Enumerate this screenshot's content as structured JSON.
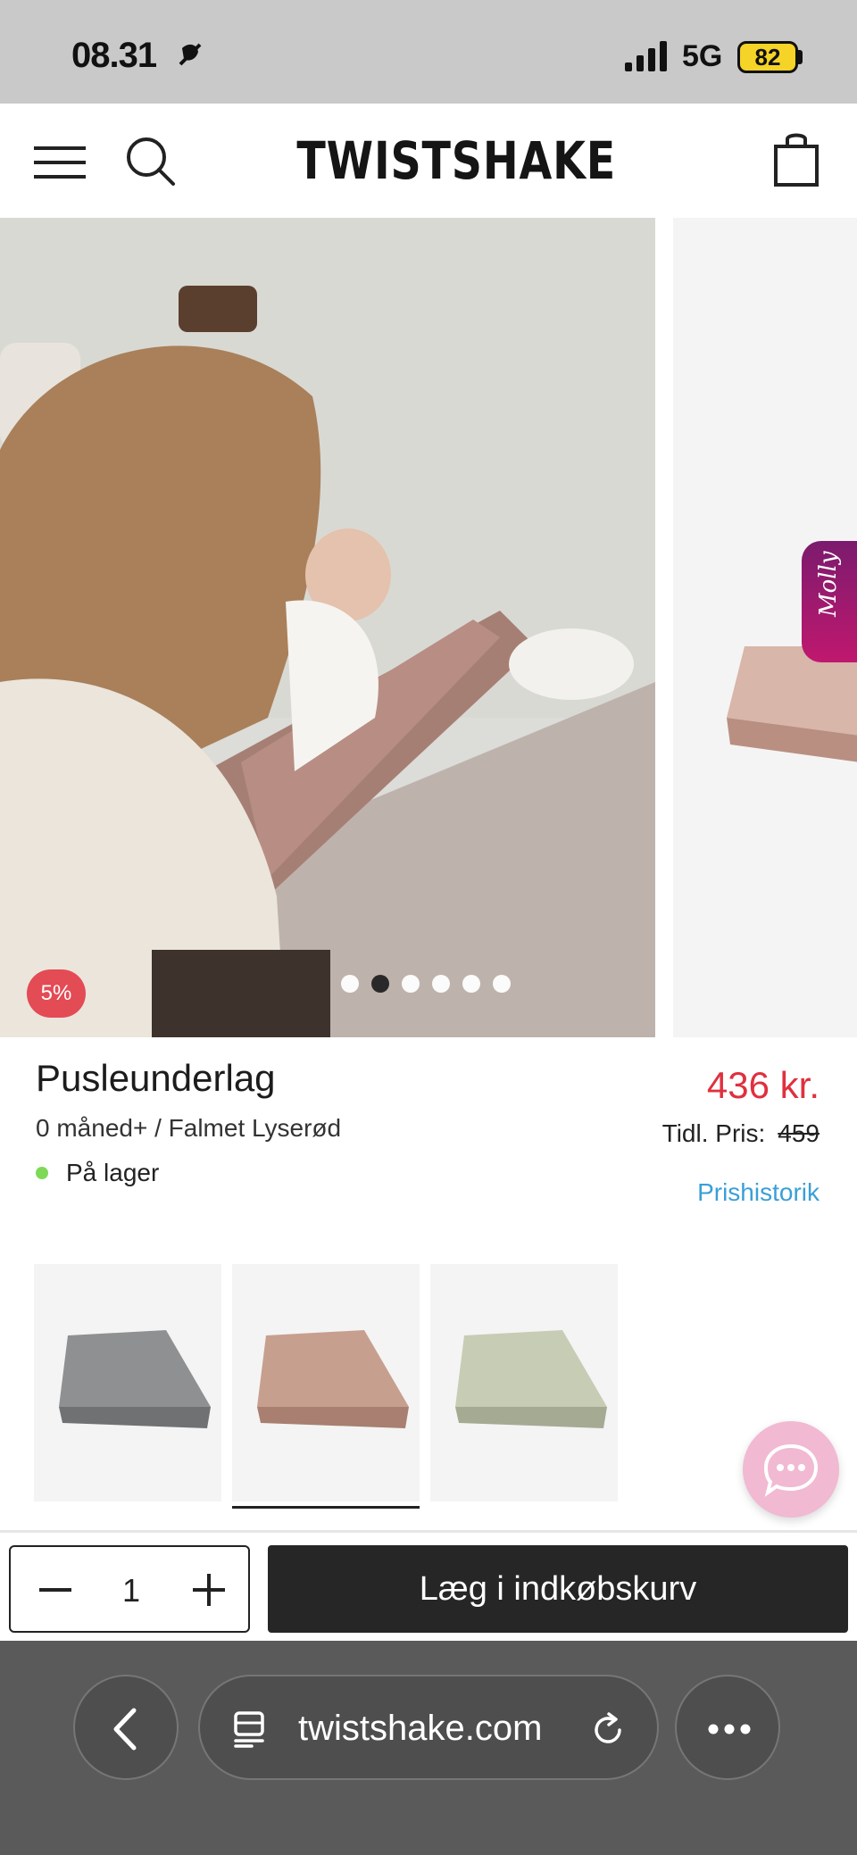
{
  "status_bar": {
    "time": "08.31",
    "network": "5G",
    "battery": "82"
  },
  "header": {
    "logo": "TWISTSHAKE",
    "icons": [
      "menu-icon",
      "search-icon",
      "cart-icon"
    ]
  },
  "gallery": {
    "badge": "5%",
    "side_tab": "Molly",
    "slide_count": 6,
    "active_slide": 2
  },
  "product": {
    "title": "Pusleunderlag",
    "variant": "0 måned+ / Falmet Lyserød",
    "stock": "På lager",
    "price": "436 kr.",
    "previous_price_label": "Tidl. Pris:",
    "previous_price": "459",
    "history_link": "Prishistorik"
  },
  "variants": [
    {
      "color_name": "grey",
      "color": "#8e9092",
      "selected": false
    },
    {
      "color_name": "pink",
      "color": "#c79f8f",
      "selected": true
    },
    {
      "color_name": "sage",
      "color": "#c7ccb4",
      "selected": false
    }
  ],
  "purchase": {
    "quantity": "1",
    "add_to_cart": "Læg i indkøbskurv"
  },
  "browser": {
    "url": "twistshake.com"
  },
  "colors": {
    "accent_red": "#e0303f",
    "link_blue": "#3a9fd6",
    "stock_green": "#7ed957",
    "button_dark": "#262626"
  }
}
